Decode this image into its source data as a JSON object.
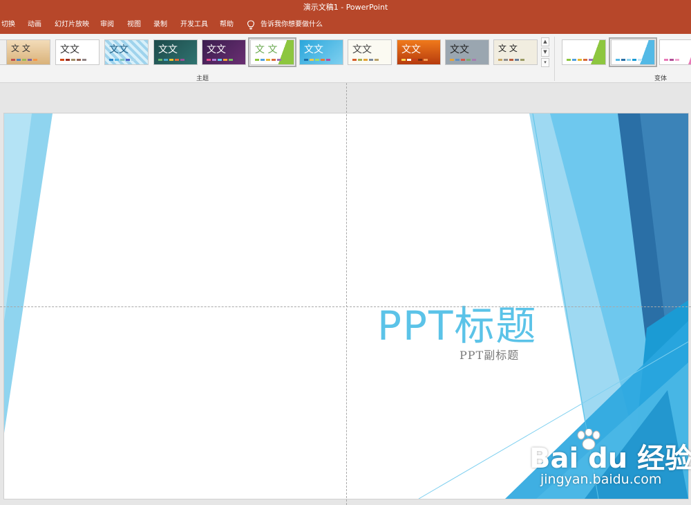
{
  "window": {
    "title": "演示文稿1 - PowerPoint"
  },
  "menu": {
    "items": [
      "切换",
      "动画",
      "幻灯片放映",
      "审阅",
      "视图",
      "录制",
      "开发工具",
      "帮助"
    ],
    "tell_me": "告诉我你想要做什么"
  },
  "ribbon": {
    "themes_label": "主题",
    "variants_label": "变体",
    "theme_sample_text": "文文",
    "theme_sample_text_alt": "文 文"
  },
  "slide": {
    "title": "PPT标题",
    "subtitle": "PPT副标题"
  },
  "watermark": {
    "brand": "Bai du 经验",
    "url": "jingyan.baidu.com"
  },
  "colors": {
    "accent": "#b7472a",
    "title_blue": "#5bc3e8",
    "facet_dark": "#2a6fa6",
    "facet_light": "#8fd4ef"
  }
}
